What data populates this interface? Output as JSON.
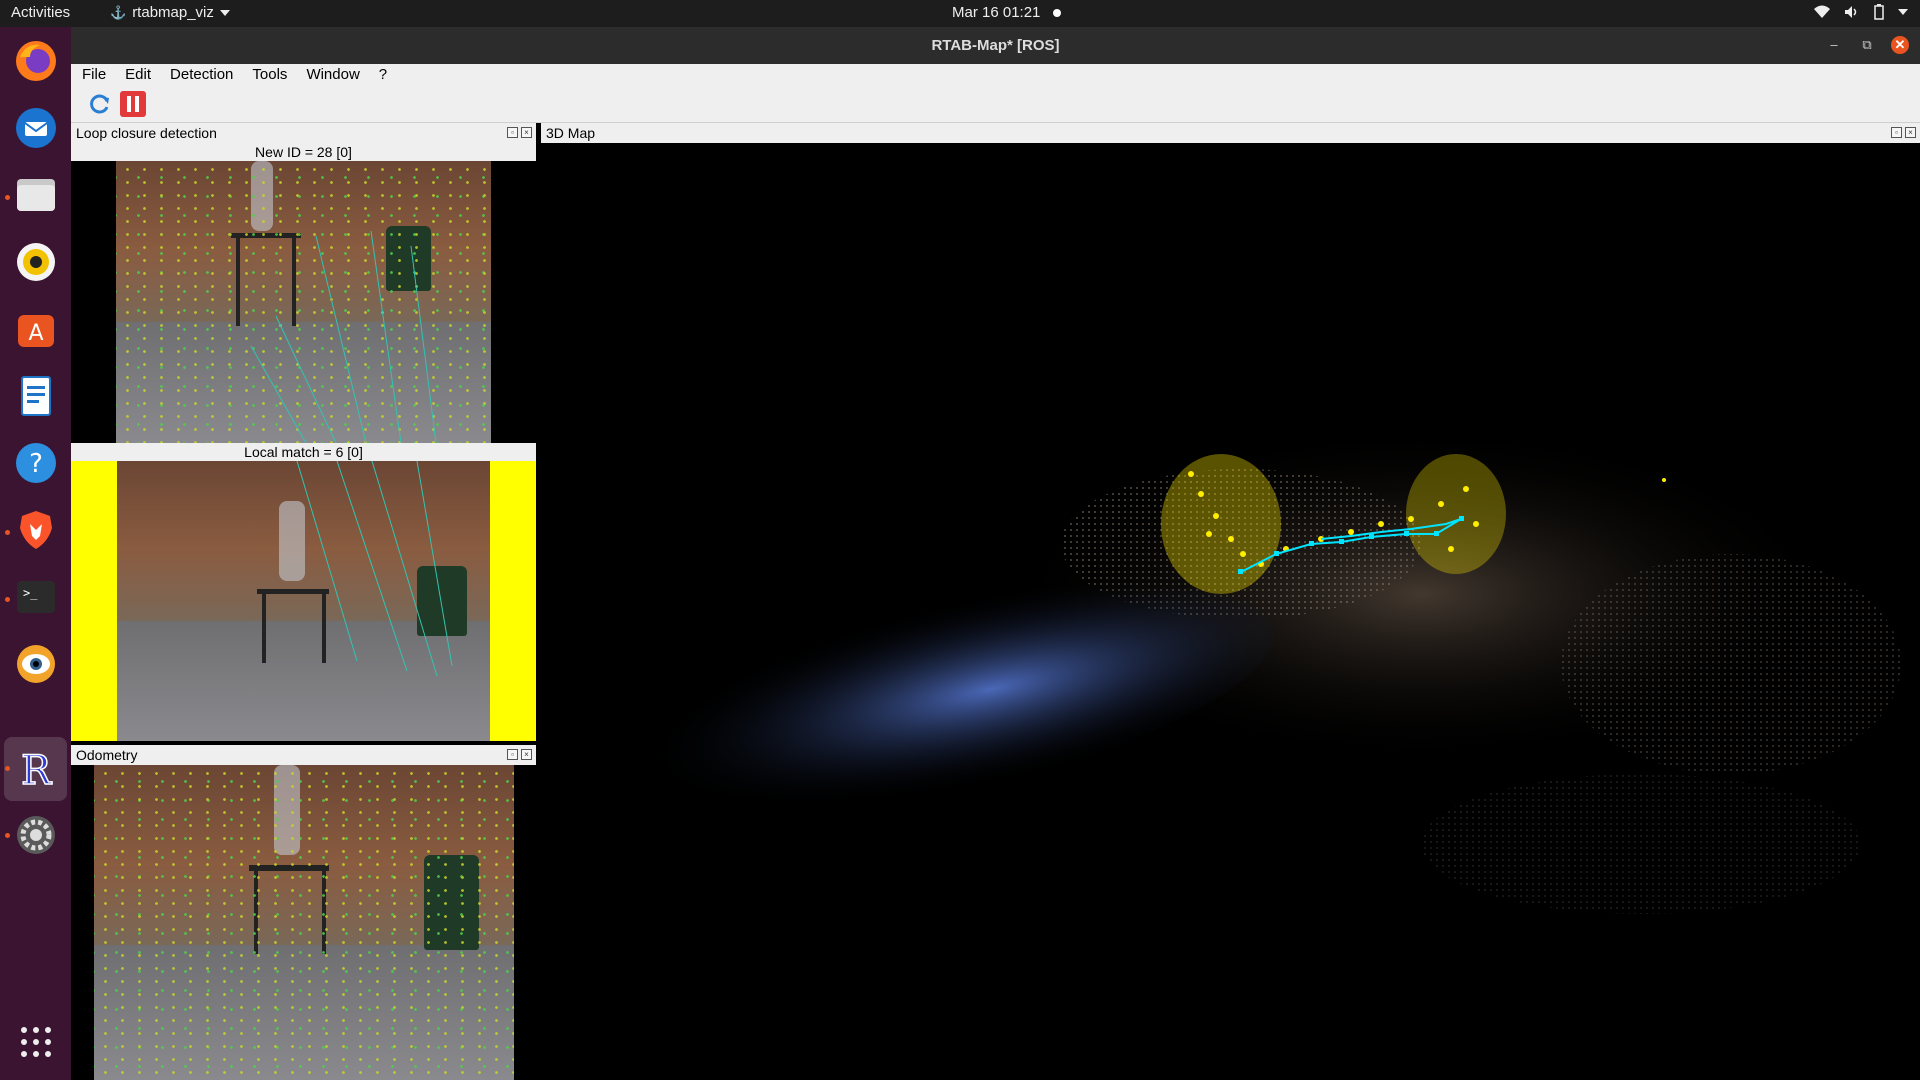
{
  "topbar": {
    "activities": "Activities",
    "app_name": "rtabmap_viz",
    "clock": "Mar 16  01:21"
  },
  "dock": {
    "items": [
      "firefox-icon",
      "thunderbird-icon",
      "files-icon",
      "rhythmbox-icon",
      "app-center-icon",
      "writer-icon",
      "help-icon",
      "brave-icon",
      "terminal-icon",
      "cheese-icon",
      "rtabmap-icon",
      "settings-icon",
      "app-grid-icon"
    ]
  },
  "window": {
    "title": "RTAB-Map* [ROS]",
    "menu": [
      "File",
      "Edit",
      "Detection",
      "Tools",
      "Window",
      "?"
    ]
  },
  "panels": {
    "loop_closure": {
      "title": "Loop closure detection",
      "new_id": "New ID = 28 [0]",
      "local_match": "Local match = 6 [0]"
    },
    "odometry": {
      "title": "Odometry"
    },
    "map3d": {
      "title": "3D Map"
    }
  },
  "colors": {
    "accent": "#e95420",
    "dock_bg": "#3a1430",
    "match_highlight": "#ffff00",
    "trajectory": "#00e5ff",
    "loop_features": "#ffee00"
  }
}
